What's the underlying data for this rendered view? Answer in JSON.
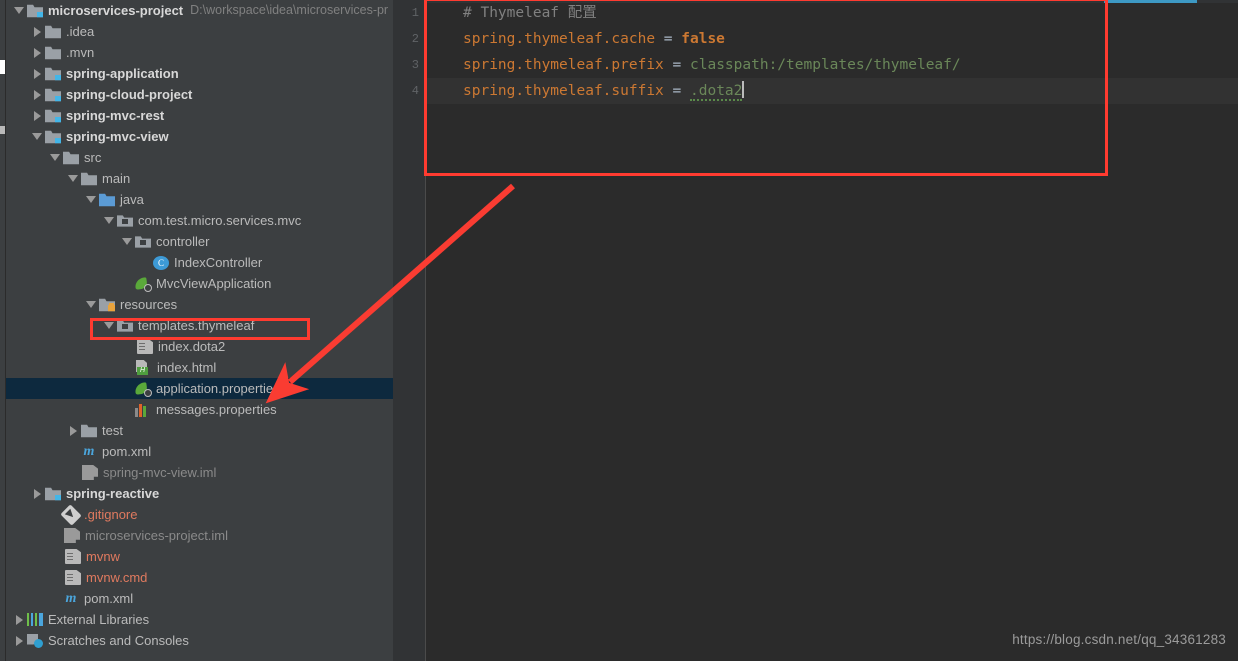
{
  "window": {
    "background": "#2b2b2b",
    "panel_background": "#3c3f41"
  },
  "project_tree": {
    "name": "Project",
    "items": [
      {
        "label": "microservices-project",
        "path_hint": "D:\\workspace\\idea\\microservices-pr",
        "icon": "module-folder-icon",
        "indent": 0,
        "arrow": "open",
        "bold": true,
        "selected": false
      },
      {
        "label": ".idea",
        "path_hint": "",
        "icon": "folder-icon",
        "indent": 1,
        "arrow": "closed",
        "bold": false,
        "selected": false
      },
      {
        "label": ".mvn",
        "path_hint": "",
        "icon": "folder-icon",
        "indent": 1,
        "arrow": "closed",
        "bold": false,
        "selected": false
      },
      {
        "label": "spring-application",
        "path_hint": "",
        "icon": "module-folder-icon",
        "indent": 1,
        "arrow": "closed",
        "bold": true,
        "selected": false
      },
      {
        "label": "spring-cloud-project",
        "path_hint": "",
        "icon": "module-folder-icon",
        "indent": 1,
        "arrow": "closed",
        "bold": true,
        "selected": false
      },
      {
        "label": "spring-mvc-rest",
        "path_hint": "",
        "icon": "module-folder-icon",
        "indent": 1,
        "arrow": "closed",
        "bold": true,
        "selected": false
      },
      {
        "label": "spring-mvc-view",
        "path_hint": "",
        "icon": "module-folder-icon",
        "indent": 1,
        "arrow": "open",
        "bold": true,
        "selected": false
      },
      {
        "label": "src",
        "path_hint": "",
        "icon": "folder-icon",
        "indent": 2,
        "arrow": "open",
        "bold": false,
        "selected": false
      },
      {
        "label": "main",
        "path_hint": "",
        "icon": "folder-icon",
        "indent": 3,
        "arrow": "open",
        "bold": false,
        "selected": false
      },
      {
        "label": "java",
        "path_hint": "",
        "icon": "source-root-icon",
        "indent": 4,
        "arrow": "open",
        "bold": false,
        "selected": false
      },
      {
        "label": "com.test.micro.services.mvc",
        "path_hint": "",
        "icon": "package-icon",
        "indent": 5,
        "arrow": "open",
        "bold": false,
        "selected": false
      },
      {
        "label": "controller",
        "path_hint": "",
        "icon": "package-icon",
        "indent": 6,
        "arrow": "open",
        "bold": false,
        "selected": false
      },
      {
        "label": "IndexController",
        "path_hint": "",
        "icon": "java-class-icon",
        "indent": 7,
        "arrow": "none",
        "bold": false,
        "selected": false
      },
      {
        "label": "MvcViewApplication",
        "path_hint": "",
        "icon": "spring-boot-app-icon",
        "indent": 6,
        "arrow": "none",
        "bold": false,
        "selected": false
      },
      {
        "label": "resources",
        "path_hint": "",
        "icon": "resources-root-icon",
        "indent": 4,
        "arrow": "open",
        "bold": false,
        "selected": false
      },
      {
        "label": "templates.thymeleaf",
        "path_hint": "",
        "icon": "package-icon",
        "indent": 5,
        "arrow": "open",
        "bold": false,
        "selected": false
      },
      {
        "label": "index.dota2",
        "path_hint": "",
        "icon": "text-file-icon",
        "indent": 6,
        "arrow": "none",
        "bold": false,
        "selected": false
      },
      {
        "label": "index.html",
        "path_hint": "",
        "icon": "html-file-icon",
        "indent": 6,
        "arrow": "none",
        "bold": false,
        "selected": false
      },
      {
        "label": "application.properties",
        "path_hint": "",
        "icon": "spring-properties-icon",
        "indent": 6,
        "arrow": "none",
        "bold": false,
        "selected": true
      },
      {
        "label": "messages.properties",
        "path_hint": "",
        "icon": "properties-file-icon",
        "indent": 6,
        "arrow": "none",
        "bold": false,
        "selected": false
      },
      {
        "label": "test",
        "path_hint": "",
        "icon": "folder-icon",
        "indent": 3,
        "arrow": "closed",
        "bold": false,
        "selected": false
      },
      {
        "label": "pom.xml",
        "path_hint": "",
        "icon": "maven-icon",
        "indent": 3,
        "arrow": "none",
        "bold": false,
        "selected": false
      },
      {
        "label": "spring-mvc-view.iml",
        "path_hint": "",
        "icon": "iml-file-icon",
        "indent": 3,
        "arrow": "none",
        "bold": false,
        "selected": false,
        "muted": true
      },
      {
        "label": "spring-reactive",
        "path_hint": "",
        "icon": "module-folder-icon",
        "indent": 1,
        "arrow": "closed",
        "bold": true,
        "selected": false
      },
      {
        "label": ".gitignore",
        "path_hint": "",
        "icon": "git-icon",
        "indent": 2,
        "arrow": "none",
        "bold": false,
        "selected": false,
        "color": "#e07a5f"
      },
      {
        "label": "microservices-project.iml",
        "path_hint": "",
        "icon": "iml-file-icon",
        "indent": 2,
        "arrow": "none",
        "bold": false,
        "selected": false,
        "muted": true
      },
      {
        "label": "mvnw",
        "path_hint": "",
        "icon": "text-file-icon",
        "indent": 2,
        "arrow": "none",
        "bold": false,
        "selected": false,
        "color": "#e07a5f"
      },
      {
        "label": "mvnw.cmd",
        "path_hint": "",
        "icon": "text-file-icon",
        "indent": 2,
        "arrow": "none",
        "bold": false,
        "selected": false,
        "color": "#e07a5f"
      },
      {
        "label": "pom.xml",
        "path_hint": "",
        "icon": "maven-icon",
        "indent": 2,
        "arrow": "none",
        "bold": false,
        "selected": false
      },
      {
        "label": "External Libraries",
        "path_hint": "",
        "icon": "libraries-icon",
        "indent": 0,
        "arrow": "closed",
        "bold": false,
        "selected": false
      },
      {
        "label": "Scratches and Consoles",
        "path_hint": "",
        "icon": "scratches-icon",
        "indent": 0,
        "arrow": "closed",
        "bold": false,
        "selected": false
      }
    ]
  },
  "editor": {
    "file": "application.properties",
    "line_numbers": [
      "1",
      "2",
      "3",
      "4"
    ],
    "current_line": 4,
    "lines": [
      {
        "n": "1",
        "tokens": [
          {
            "t": "# Thymeleaf 配置",
            "c": "comment"
          }
        ]
      },
      {
        "n": "2",
        "tokens": [
          {
            "t": "spring.thymeleaf.cache",
            "c": "key"
          },
          {
            "t": " = ",
            "c": "eq"
          },
          {
            "t": "false",
            "c": "bool"
          }
        ]
      },
      {
        "n": "3",
        "tokens": [
          {
            "t": "spring.thymeleaf.prefix",
            "c": "key"
          },
          {
            "t": " = ",
            "c": "eq"
          },
          {
            "t": "classpath:/templates/thymeleaf/",
            "c": "val"
          }
        ]
      },
      {
        "n": "4",
        "tokens": [
          {
            "t": "spring.thymeleaf.suffix",
            "c": "key"
          },
          {
            "t": " = ",
            "c": "eq"
          },
          {
            "t": ".dota2",
            "c": "val-typo"
          }
        ]
      }
    ],
    "colors": {
      "comment": "#808080",
      "key": "#cc7832",
      "value": "#6a8759",
      "equals": "#a9b7c6",
      "background": "#2b2b2b",
      "current_line_bg": "#323232",
      "gutter_bg": "#313335",
      "scrollbar_accent": "#3d99c4"
    }
  },
  "annotations": {
    "rect_editor": {
      "label": "editor-highlight-box",
      "color": "#ff3b30"
    },
    "rect_tree": {
      "label": "templates-thymeleaf-highlight-box",
      "color": "#ff3b30"
    },
    "arrow": {
      "label": "pointer-arrow",
      "color": "#fa3c32"
    }
  },
  "watermark": {
    "text": "https://blog.csdn.net/qq_34361283"
  }
}
